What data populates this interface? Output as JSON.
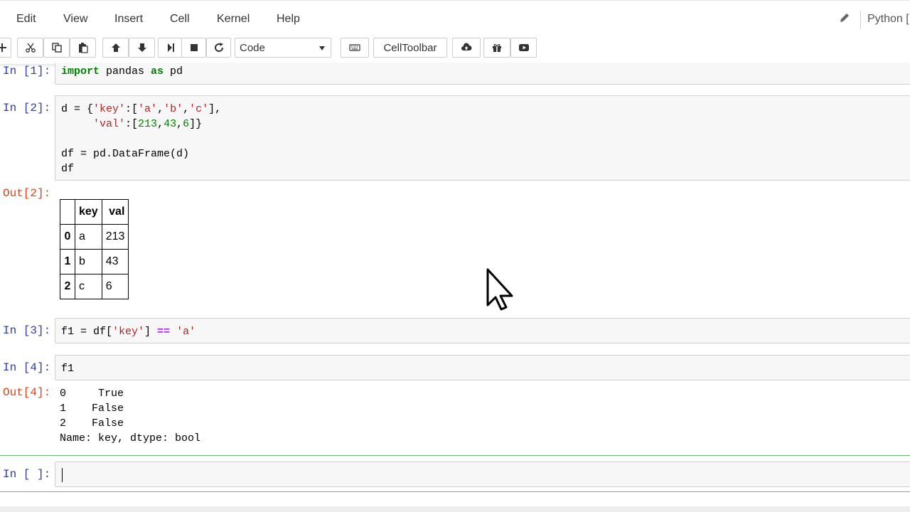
{
  "menubar": {
    "items": [
      "Edit",
      "View",
      "Insert",
      "Cell",
      "Kernel",
      "Help"
    ],
    "kernel_name": "Python ["
  },
  "toolbar": {
    "cell_type": "Code",
    "celltoolbar_label": "CellToolbar",
    "icons": [
      "add-cell-icon",
      "cut-icon",
      "copy-icon",
      "paste-icon",
      "move-up-icon",
      "move-down-icon",
      "run-icon",
      "stop-icon",
      "restart-icon",
      "keyboard-icon",
      "cloud-upload-icon",
      "gift-icon",
      "youtube-icon"
    ]
  },
  "cells": [
    {
      "prompt": "In [1]:",
      "lines": [
        "import pandas as pd"
      ]
    },
    {
      "prompt": "In [2]:",
      "lines": [
        "d = {'key':['a','b','c'],",
        "     'val':[213,43,6]}",
        "",
        "df = pd.DataFrame(d)",
        "df"
      ]
    },
    {
      "prompt": "In [3]:",
      "lines": [
        "f1 = df['key'] == 'a'"
      ]
    },
    {
      "prompt": "In [4]:",
      "lines": [
        "f1"
      ]
    },
    {
      "prompt": "In [ ]:",
      "lines": [
        ""
      ]
    }
  ],
  "outputs": {
    "out2_prompt": "Out[2]:",
    "dataframe": {
      "columns": [
        "",
        "key",
        "val"
      ],
      "rows": [
        [
          "0",
          "a",
          "213"
        ],
        [
          "1",
          "b",
          "43"
        ],
        [
          "2",
          "c",
          "6"
        ]
      ]
    },
    "out4_prompt": "Out[4]:",
    "out4_text": "0     True\n1    False\n2    False\nName: key, dtype: bool"
  }
}
